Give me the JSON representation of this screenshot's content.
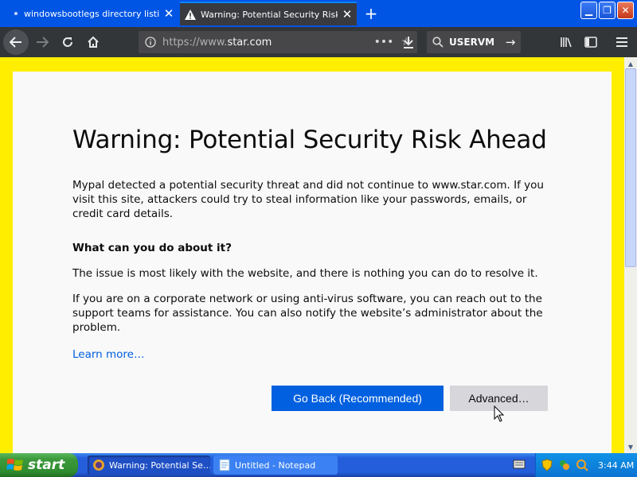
{
  "browser": {
    "tabs": [
      {
        "title": "windowsbootlegs directory listing",
        "active": false
      },
      {
        "title": "Warning: Potential Security Risk A",
        "active": true
      }
    ],
    "new_tab_icon": "plus-icon",
    "url": {
      "prefix": "https://www.",
      "host": "star.com"
    },
    "search_text": "USERVM"
  },
  "page": {
    "title": "Warning: Potential Security Risk Ahead",
    "intro": "Mypal detected a potential security threat and did not continue to www.star.com. If you visit this site, attackers could try to steal information like your passwords, emails, or credit card details.",
    "question": "What can you do about it?",
    "para1": "The issue is most likely with the website, and there is nothing you can do to resolve it.",
    "para2": "If you are on a corporate network or using anti-virus software, you can reach out to the support teams for assistance. You can also notify the website’s administrator about the problem.",
    "learn_more": "Learn more…",
    "back_button": "Go Back (Recommended)",
    "advanced_button": "Advanced…"
  },
  "taskbar": {
    "start_label": "start",
    "tasks": [
      {
        "label": "Warning: Potential Se…",
        "active": true
      },
      {
        "label": "Untitled - Notepad",
        "active": false
      }
    ],
    "clock": "3:44 AM"
  },
  "colors": {
    "page_border": "#ffee00",
    "accent_blue": "#0060df",
    "tab_bar": "#0055e5"
  }
}
